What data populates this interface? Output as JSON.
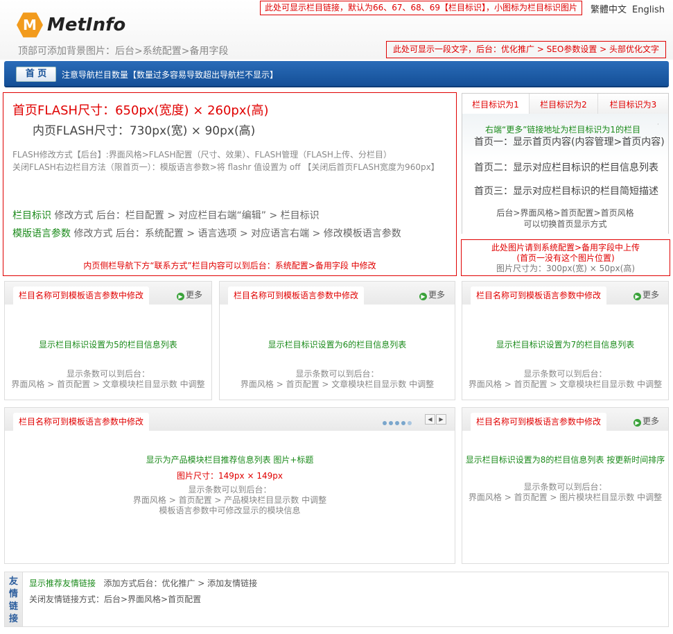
{
  "header": {
    "logo_letter": "M",
    "logo_text": "MetInfo",
    "top_links_note": "此处可显示栏目链接，默认为66、67、68、69【栏目标识】，小图标为栏目标识图片",
    "lang_traditional": "繁體中文",
    "lang_english": "English",
    "bg_tip": "顶部可添加背景图片：后台>系统配置>备用字段",
    "seo_note": "此处可显示一段文字，后台：优化推广 > SEO参数设置 > 头部优化文字"
  },
  "nav": {
    "home": "首 页",
    "note": "注意导航栏目数量【数量过多容易导致超出导航栏不显示】"
  },
  "flash": {
    "size_home": "首页FLASH尺寸：650px(宽度) × 260px(高)",
    "size_inner": "内页FLASH尺寸：730px(宽) × 90px(高)",
    "modify": "FLASH修改方式【后台】:界面风格>FLASH配置（尺寸、效果）、FLASH管理（FLASH上传、分栏目）",
    "close": "关闭FLASH右边栏目方法（限首页一）：模版语言参数>将 flashr 值设置为 off 【关闭后首页FLASH宽度为960px】",
    "col_id_label": "栏目标识",
    "col_id_text": " 修改方式 后台：栏目配置 >  对应栏目右端“编辑” > 栏目标识",
    "lang_label": "模版语言参数",
    "lang_text": " 修改方式 后台：系统配置 > 语言选项 > 对应语言右端 > 修改模板语言参数",
    "contact": "内页侧栏导航下方“联系方式”栏目内容可以到后台：系统配置>备用字段 中修改"
  },
  "tabs": {
    "tab1": "栏目标识为1",
    "tab2": "栏目标识为2",
    "tab3": "栏目标识为3",
    "more_note": "右端“更多”链接地址为栏目标识为1的栏目",
    "dot": "·",
    "line1": "首页一：显示首页内容(内容管理>首页内容)",
    "line2": "首页二：显示对应栏目标识的栏目信息列表",
    "line3": "首页三：显示对应栏目标识的栏目简短描述",
    "foot1": "后台>界面风格>首页配置>首页风格",
    "foot2": "可以切换首页显示方式"
  },
  "image_note": {
    "line1": "此处图片请到系统配置>备用字段中上传",
    "line2": "(首页一没有这个图片位置)",
    "line3": "图片尺寸为：300px(宽) × 50px(高)"
  },
  "common": {
    "col_title": "栏目名称可到模板语言参数中修改",
    "more": "更多",
    "count_note": "显示条数可以到后台：",
    "count_path_article": "界面风格 > 首页配置 > 文章模块栏目显示数 中调整",
    "count_path_image": "界面风格 > 首页配置 > 图片模块栏目显示数 中调整"
  },
  "columns": [
    {
      "list": "显示栏目标识设置为5的栏目信息列表"
    },
    {
      "list": "显示栏目标识设置为6的栏目信息列表"
    },
    {
      "list": "显示栏目标识设置为7的栏目信息列表"
    }
  ],
  "product": {
    "list": "显示为产品模块栏目推荐信息列表  图片+标题",
    "size": "图片尺寸：149px × 149px",
    "count_note": "显示条数可以到后台：",
    "count_path": "界面风格 > 首页配置 > 产品模块栏目显示数  中调整",
    "lang_note": "模板语言参数中可修改显示的模块信息"
  },
  "col8": {
    "list": "显示栏目标识设置为8的栏目信息列表  按更新时间排序"
  },
  "links": {
    "side": "友情链接",
    "title": "显示推荐友情链接",
    "add": "   添加方式后台：优化推广 > 添加友情链接",
    "close": "关闭友情链接方式：后台>界面风格>首页配置"
  },
  "colors": {
    "accent_red": "#e00000",
    "green": "#1a8a1a",
    "nav_blue": "#1e5ea8",
    "logo_orange": "#f29b1d"
  }
}
